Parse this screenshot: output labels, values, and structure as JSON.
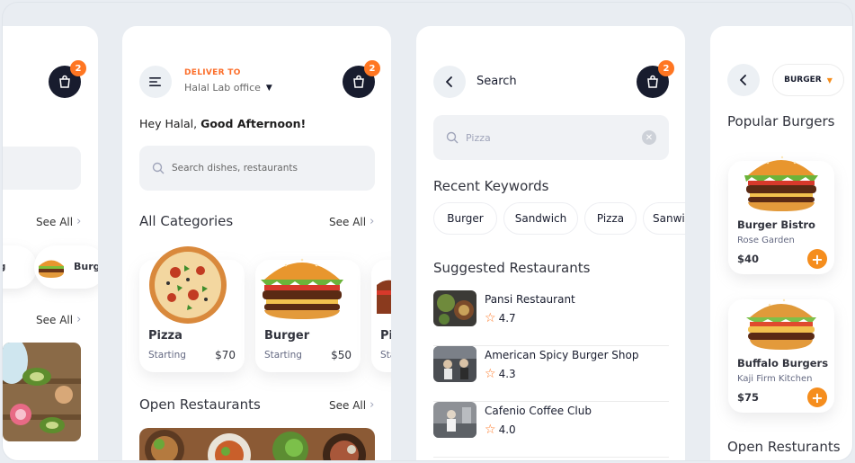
{
  "colors": {
    "accent": "#ff7622",
    "dark": "#181c2e",
    "field": "#f0f2f5",
    "background": "#e9edf2"
  },
  "cart": {
    "badge_count": "2"
  },
  "panel1": {
    "see_all_1": "See All",
    "see_all_2": "See All",
    "chip_left": "og",
    "chip_right": "Burg"
  },
  "home": {
    "deliver_label": "DELIVER TO",
    "location": "Halal Lab office",
    "greeting_prefix": "Hey Halal, ",
    "greeting_bold": "Good Afternoon!",
    "search_placeholder": "Search dishes, restaurants",
    "categories_title": "All Categories",
    "see_all": "See All",
    "categories": [
      {
        "name": "Pizza",
        "starting": "Starting",
        "price": "$70"
      },
      {
        "name": "Burger",
        "starting": "Starting",
        "price": "$50"
      },
      {
        "name": "Pi",
        "starting": "Sta",
        "price": ""
      }
    ],
    "open_title": "Open Restaurants",
    "open_see_all": "See All"
  },
  "search": {
    "title": "Search",
    "query": "Pizza",
    "recent_title": "Recent Keywords",
    "keywords": [
      "Burger",
      "Sandwich",
      "Pizza",
      "Sanwi"
    ],
    "suggested_title": "Suggested Restaurants",
    "restaurants": [
      {
        "name": "Pansi Restaurant",
        "rating": "4.7"
      },
      {
        "name": "American Spicy Burger Shop",
        "rating": "4.3"
      },
      {
        "name": "Cafenio Coffee Club",
        "rating": "4.0"
      }
    ]
  },
  "burger": {
    "dropdown_label": "BURGER",
    "popular_title": "Popular Burgers",
    "items": [
      {
        "name": "Burger Bistro",
        "restaurant": "Rose Garden",
        "price": "$40"
      },
      {
        "name": "Buffalo Burgers",
        "restaurant": "Kaji Firm Kitchen",
        "price": "$75"
      }
    ],
    "open_title": "Open Resturants"
  }
}
